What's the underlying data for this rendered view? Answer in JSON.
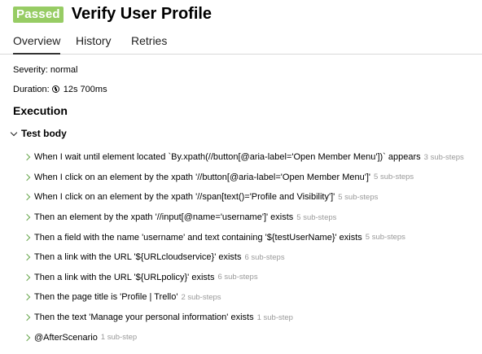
{
  "header": {
    "status": "Passed",
    "title": "Verify User Profile",
    "status_color": "#97cc64"
  },
  "tabs": [
    {
      "label": "Overview",
      "active": true
    },
    {
      "label": "History",
      "active": false
    },
    {
      "label": "Retries",
      "active": false
    }
  ],
  "meta": {
    "severity": "Severity: normal",
    "duration_label": "Duration:",
    "duration_value": "12s 700ms",
    "duration_icon": "clock-icon"
  },
  "execution": {
    "title": "Execution",
    "test_body": "Test body",
    "steps": [
      {
        "text": "When I wait until element located `By.xpath(//button[@aria-label='Open Member Menu'])` appears",
        "substeps": "3 sub-steps"
      },
      {
        "text": "When I click on an element by the xpath '//button[@aria-label='Open Member Menu']'",
        "substeps": "5 sub-steps"
      },
      {
        "text": "When I click on an element by the xpath '//span[text()='Profile and Visibility']'",
        "substeps": "5 sub-steps"
      },
      {
        "text": "Then an element by the xpath '//input[@name='username']' exists",
        "substeps": "5 sub-steps"
      },
      {
        "text": "Then a field with the name 'username' and text containing '${testUserName}' exists",
        "substeps": "5 sub-steps"
      },
      {
        "text": "Then a link with the URL '${URLcloudservice}' exists",
        "substeps": "6 sub-steps"
      },
      {
        "text": "Then a link with the URL '${URLpolicy}' exists",
        "substeps": "6 sub-steps"
      },
      {
        "text": "Then the page title is 'Profile | Trello'",
        "substeps": "2 sub-steps"
      },
      {
        "text": "Then the text 'Manage your personal information' exists",
        "substeps": "1 sub-step"
      },
      {
        "text": "@AfterScenario",
        "substeps": "1 sub-step"
      }
    ]
  }
}
